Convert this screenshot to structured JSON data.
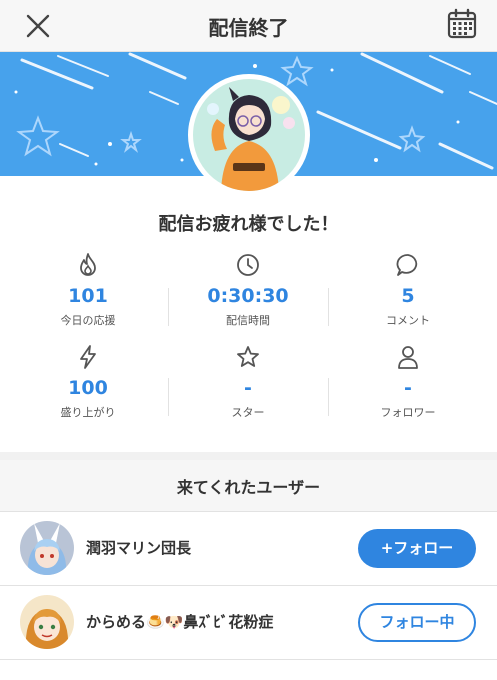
{
  "header": {
    "title": "配信終了",
    "close_icon": "close-icon",
    "calendar_icon": "calendar-icon"
  },
  "colors": {
    "accent": "#2f85e0",
    "banner": "#47a2ec"
  },
  "main": {
    "thanks_message": "配信お疲れ様でした！"
  },
  "stats": [
    {
      "icon": "flame-icon",
      "value": "101",
      "label": "今日の応援"
    },
    {
      "icon": "clock-icon",
      "value": "0:30:30",
      "label": "配信時間"
    },
    {
      "icon": "comment-icon",
      "value": "5",
      "label": "コメント"
    },
    {
      "icon": "lightning-icon",
      "value": "100",
      "label": "盛り上がり"
    },
    {
      "icon": "star-icon",
      "value": "-",
      "label": "スター"
    },
    {
      "icon": "user-icon",
      "value": "-",
      "label": "フォロワー"
    }
  ],
  "visitors": {
    "title": "来てくれたユーザー",
    "users": [
      {
        "name": "潤羽マリン団長",
        "button": "+フォロー"
      },
      {
        "name": "からめる🍮🐶鼻ｽﾞﾋﾞ花粉症",
        "button": "フォロー中"
      }
    ]
  }
}
